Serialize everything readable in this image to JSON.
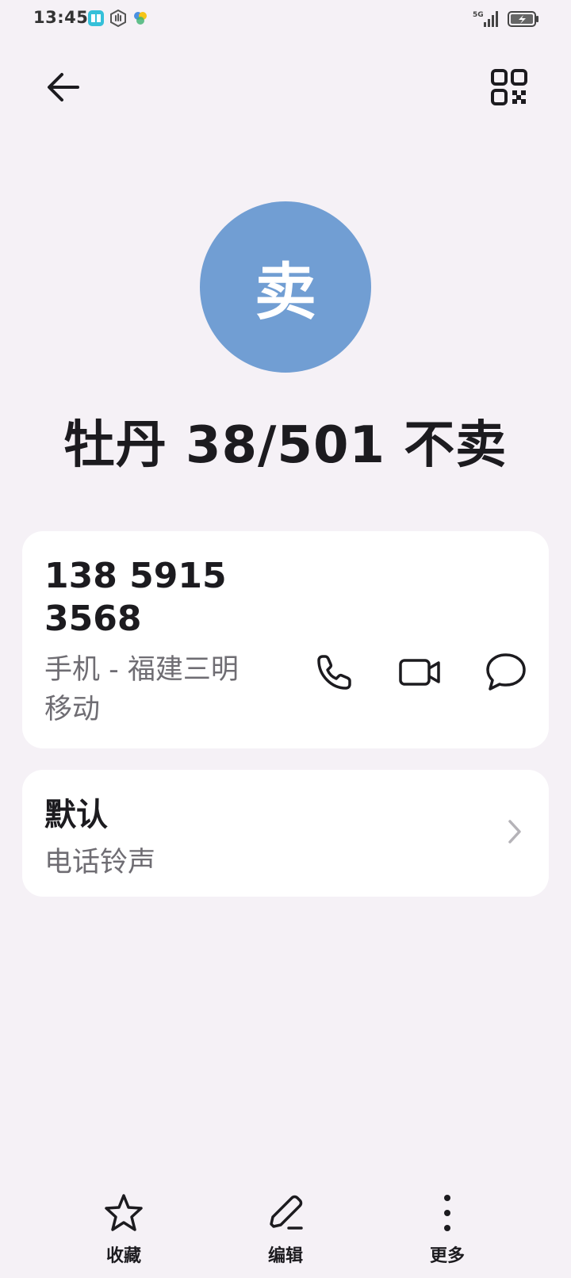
{
  "status_bar": {
    "time": "13:45",
    "network": "5G",
    "icons": [
      "book-app-icon",
      "hand-icon",
      "pinwheel-icon"
    ]
  },
  "header": {
    "back_icon": "arrow-left-icon",
    "qr_icon": "qr-code-icon"
  },
  "contact": {
    "avatar_initial": "卖",
    "avatar_color": "#719ed3",
    "name": "牡丹 38/501 不卖"
  },
  "phone": {
    "number_line1": "138 5915",
    "number_line2": "3568",
    "type_line1": "手机 - 福建三明",
    "type_line2": "移动",
    "actions": [
      "phone-icon",
      "video-icon",
      "message-icon"
    ]
  },
  "ringtone": {
    "title": "默认",
    "subtitle": "电话铃声"
  },
  "bottom_bar": {
    "favorite_label": "收藏",
    "edit_label": "编辑",
    "more_label": "更多"
  }
}
